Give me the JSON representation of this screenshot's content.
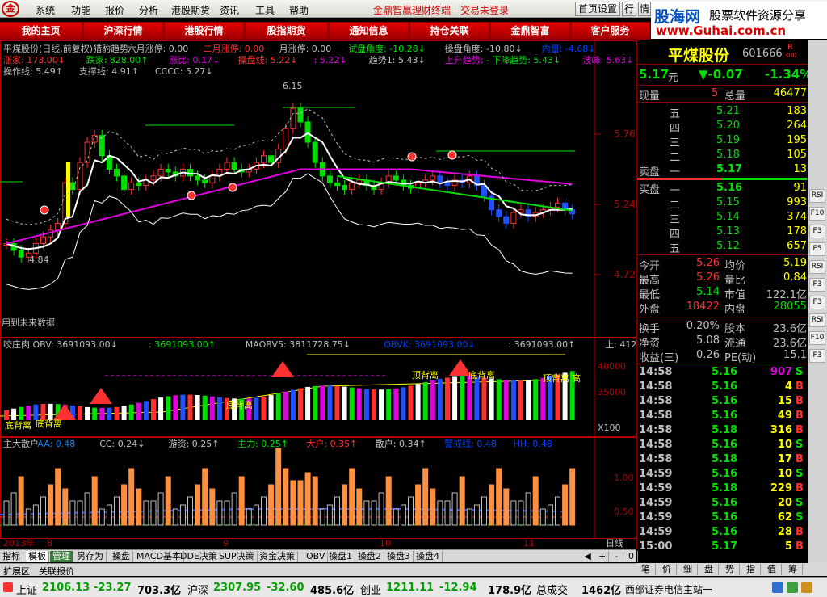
{
  "menubar": {
    "logo": "金鼎",
    "items": [
      "系统",
      "功能",
      "报价",
      "分析",
      "港股期货",
      "资讯",
      "工具",
      "帮助"
    ],
    "title": "金鼎智赢理财终端 - 交易未登录",
    "buttons": [
      "首页设置",
      "行",
      "情"
    ]
  },
  "brand": {
    "site": "股海网",
    "tagline": "股票软件资源分享",
    "url": "www.Guhai.com.cn"
  },
  "nav": [
    "我的主页",
    "沪深行情",
    "港股行情",
    "股指期货",
    "通知信息",
    "持仓关联",
    "金鼎智富",
    "客户服务"
  ],
  "colors": {
    "up": "#ff3030",
    "down": "#00e000",
    "accent": "#ffff00",
    "purple": "#e000e0"
  },
  "price_chart": {
    "header_line1": [
      {
        "t": "平煤股份(日线,前复权)",
        "c": "#c0c0c0"
      },
      {
        "t": "猎豹趋势",
        "c": "#c0c0c0"
      },
      {
        "t": "六月涨停: 0.00",
        "c": "#c0c0c0"
      },
      {
        "t": "二月涨停: 0.00",
        "c": "#ff3030"
      },
      {
        "t": "月涨停: 0.00",
        "c": "#c0c0c0"
      },
      {
        "t": "试盘角度: -10.28↓",
        "c": "#00e000"
      },
      {
        "t": "操盘角度: -10.80↓",
        "c": "#c0c0c0"
      },
      {
        "t": "内量: -4.68↓",
        "c": "#0040ff"
      }
    ],
    "header_line2": [
      {
        "t": "涨家: 173.00↓",
        "c": "#ff3030"
      },
      {
        "t": "跌家: 828.00↑",
        "c": "#00e000"
      },
      {
        "t": "涨比: 0.17↓",
        "c": "#e000e0"
      },
      {
        "t": "操盘线: 5.22↓",
        "c": "#ff3030"
      },
      {
        "t": ": 5.22↓",
        "c": "#e000e0"
      },
      {
        "t": "趋势1: 5.43↓",
        "c": "#c0c0c0"
      },
      {
        "t": "上升趋势:",
        "c": "#e000e0"
      },
      {
        "t": "- 下降趋势: 5.43↓",
        "c": "#00e000"
      },
      {
        "t": "波峰: 5.63↓",
        "c": "#e000e0"
      }
    ],
    "header_line3": [
      {
        "t": "操作线: 5.49↑",
        "c": "#c0c0c0"
      },
      {
        "t": "支撑线: 4.91↑",
        "c": "#c0c0c0"
      },
      {
        "t": "CCCC: 5.27↓",
        "c": "#c0c0c0"
      }
    ],
    "y_labels": [
      "5.76",
      "5.24",
      "4.72"
    ],
    "high_label": "6.15",
    "low_label": "4.84",
    "future_note": "用到未来数据"
  },
  "obv_panel": {
    "header": [
      {
        "t": "咬庄肉 OBV: 3691093.00↓",
        "c": "#c0c0c0"
      },
      {
        "t": ": 3691093.00↑",
        "c": "#00e000"
      },
      {
        "t": "MAOBV5: 3811728.75↓",
        "c": "#c0c0c0"
      },
      {
        "t": "OBVK: 3691093.00↓",
        "c": "#0040ff"
      },
      {
        "t": ": 3691093.00↑",
        "c": "#c0c0c0"
      },
      {
        "t": "上: 4122211.50",
        "c": "#c0c0c0"
      }
    ],
    "y_labels": [
      "40000",
      "35000"
    ],
    "scale": "X100",
    "tags": [
      "底背离",
      "底背离",
      "底背离",
      "顶背离",
      "底背离",
      "顶背离",
      "高"
    ]
  },
  "vol_panel": {
    "header": [
      {
        "t": "主大散户",
        "c": "#c0c0c0"
      },
      {
        "t": "AA: 0.48",
        "c": "#0080ff"
      },
      {
        "t": "CC: 0.24↓",
        "c": "#c0c0c0"
      },
      {
        "t": "游资: 0.25↑",
        "c": "#c0c0c0"
      },
      {
        "t": "主力: 0.25↑",
        "c": "#00e000"
      },
      {
        "t": "大户: 0.35↑",
        "c": "#ff3030"
      },
      {
        "t": "散户: 0.34↑",
        "c": "#c0c0c0"
      },
      {
        "t": "警戒线: 0.48",
        "c": "#0040ff"
      },
      {
        "t": "HH: 0.48",
        "c": "#0040ff"
      }
    ],
    "y_labels": [
      "1.00",
      "0.50"
    ]
  },
  "x_axis": {
    "labels": [
      "2013年",
      "8",
      "9",
      "10",
      "11"
    ],
    "period": "日线"
  },
  "right_panel": {
    "name": "平煤股份",
    "code": "601666",
    "badge": "R",
    "badge2": "300",
    "price": "5.17",
    "price_unit": "元",
    "change": "▼-0.07",
    "change_pct": "-1.34%",
    "xianliang_label": "现量",
    "xianliang": "5",
    "zongliang_label": "总量",
    "zongliang": "46477",
    "sell_label": "卖盘",
    "buy_label": "买盘",
    "sell": [
      {
        "lv": "五",
        "p": "5.21",
        "v": "183"
      },
      {
        "lv": "四",
        "p": "5.20",
        "v": "264"
      },
      {
        "lv": "三",
        "p": "5.19",
        "v": "195"
      },
      {
        "lv": "二",
        "p": "5.18",
        "v": "105"
      },
      {
        "lv": "一",
        "p": "5.17",
        "v": "13"
      }
    ],
    "buy": [
      {
        "lv": "一",
        "p": "5.16",
        "v": "91"
      },
      {
        "lv": "二",
        "p": "5.15",
        "v": "993"
      },
      {
        "lv": "三",
        "p": "5.14",
        "v": "374"
      },
      {
        "lv": "四",
        "p": "5.13",
        "v": "178"
      },
      {
        "lv": "五",
        "p": "5.12",
        "v": "657"
      }
    ],
    "stats": [
      {
        "l": "今开",
        "v": "5.26",
        "vc": "#ff3030",
        "l2": "均价",
        "v2": "5.19",
        "v2c": "#ffff00"
      },
      {
        "l": "最高",
        "v": "5.26",
        "vc": "#ff3030",
        "l2": "量比",
        "v2": "0.84",
        "v2c": "#ffff00"
      },
      {
        "l": "最低",
        "v": "5.14",
        "vc": "#00e000",
        "l2": "市值",
        "v2": "122.1亿",
        "v2c": "#c0c0c0"
      },
      {
        "l": "外盘",
        "v": "18422",
        "vc": "#ff3030",
        "l2": "内盘",
        "v2": "28055",
        "v2c": "#00e000"
      }
    ],
    "stats2": [
      {
        "l": "换手",
        "v": "0.20%",
        "l2": "股本",
        "v2": "23.6亿"
      },
      {
        "l": "净资",
        "v": "5.08",
        "l2": "流通",
        "v2": "23.6亿"
      },
      {
        "l": "收益(三)",
        "v": "0.26",
        "l2": "PE(动)",
        "v2": "15.1"
      }
    ],
    "ticks": [
      {
        "t": "14:58",
        "p": "5.16",
        "v": "907",
        "s": "S"
      },
      {
        "t": "14:58",
        "p": "5.16",
        "v": "4",
        "s": "B"
      },
      {
        "t": "14:58",
        "p": "5.16",
        "v": "15",
        "s": "B"
      },
      {
        "t": "14:58",
        "p": "5.16",
        "v": "49",
        "s": "B"
      },
      {
        "t": "14:58",
        "p": "5.18",
        "v": "316",
        "s": "B"
      },
      {
        "t": "14:58",
        "p": "5.16",
        "v": "10",
        "s": "S"
      },
      {
        "t": "14:58",
        "p": "5.18",
        "v": "17",
        "s": "B"
      },
      {
        "t": "14:59",
        "p": "5.16",
        "v": "10",
        "s": "S"
      },
      {
        "t": "14:59",
        "p": "5.18",
        "v": "229",
        "s": "B"
      },
      {
        "t": "14:59",
        "p": "5.16",
        "v": "20",
        "s": "S"
      },
      {
        "t": "14:59",
        "p": "5.16",
        "v": "62",
        "s": "S"
      },
      {
        "t": "14:59",
        "p": "5.16",
        "v": "28",
        "s": "B"
      },
      {
        "t": "15:00",
        "p": "5.17",
        "v": "5",
        "s": "B"
      }
    ]
  },
  "side_tabs": [
    "RSI",
    "F10",
    "F3",
    "F5",
    "RSI",
    "F3",
    "F3",
    "RSI",
    "F10",
    "F3"
  ],
  "bottom_tabs": [
    "指标",
    "模板",
    "管理",
    "另存为",
    "操盘",
    "MACD基本",
    "DDE决策",
    "SUP决策",
    "资金决策",
    "OBV",
    "操盘1",
    "操盘2",
    "操盘3",
    "操盘4"
  ],
  "bottom_ctrl": [
    "◀",
    "+",
    "-",
    "0"
  ],
  "expand": [
    "扩展区",
    "关联报价"
  ],
  "right_tabs": [
    "笔",
    "价",
    "细",
    "盘",
    "势",
    "指",
    "值",
    "筹"
  ],
  "status": {
    "sh_label": "上证",
    "sh": "2106.13",
    "sh_chg": "-23.27",
    "sh_amt": "703.3亿",
    "hs_label": "沪深",
    "hs": "2307.95",
    "hs_chg": "-32.60",
    "hs_amt": "485.6亿",
    "cy_label": "创业",
    "cy": "1211.11",
    "cy_chg": "-12.94",
    "cy_amt": "178.9亿",
    "total_label": "总成交",
    "total": "1462亿",
    "broker": "西部证券电信主站一"
  }
}
